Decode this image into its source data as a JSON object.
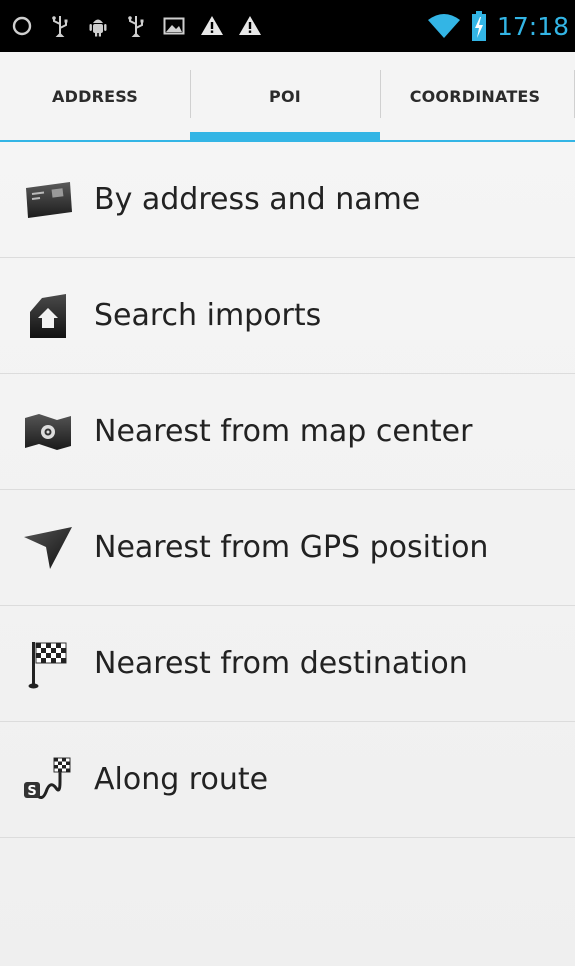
{
  "status_bar": {
    "time": "17:18",
    "icons": [
      "circle-outline-icon",
      "usb-icon",
      "android-debug-icon",
      "usb-icon",
      "image-icon",
      "warning-icon",
      "warning-icon",
      "wifi-icon",
      "battery-charging-icon"
    ]
  },
  "tabs": [
    {
      "label": "ADDRESS",
      "selected": false
    },
    {
      "label": "POI",
      "selected": true
    },
    {
      "label": "COORDINATES",
      "selected": false
    }
  ],
  "menu": [
    {
      "label": "By address and name",
      "icon": "address-card-icon"
    },
    {
      "label": "Search imports",
      "icon": "home-import-icon"
    },
    {
      "label": "Nearest from map center",
      "icon": "map-center-icon"
    },
    {
      "label": "Nearest from GPS position",
      "icon": "gps-arrow-icon"
    },
    {
      "label": "Nearest from destination",
      "icon": "destination-flag-icon"
    },
    {
      "label": "Along route",
      "icon": "route-icon"
    }
  ],
  "colors": {
    "accent": "#33b5e5",
    "status_bar": "#000000",
    "text": "#222222"
  }
}
